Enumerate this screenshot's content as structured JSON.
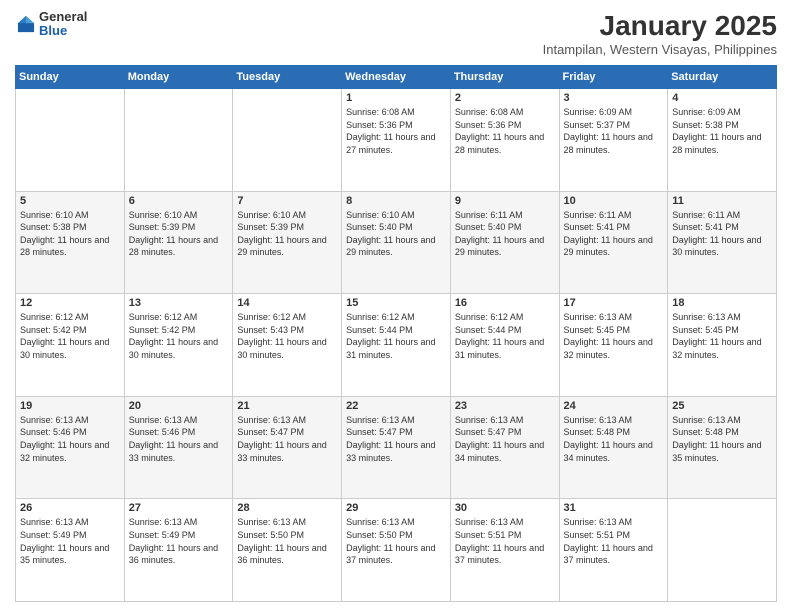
{
  "header": {
    "logo": {
      "general": "General",
      "blue": "Blue"
    },
    "title": "January 2025",
    "subtitle": "Intampilan, Western Visayas, Philippines"
  },
  "weekdays": [
    "Sunday",
    "Monday",
    "Tuesday",
    "Wednesday",
    "Thursday",
    "Friday",
    "Saturday"
  ],
  "weeks": [
    [
      {
        "day": "",
        "sunrise": "",
        "sunset": "",
        "daylight": ""
      },
      {
        "day": "",
        "sunrise": "",
        "sunset": "",
        "daylight": ""
      },
      {
        "day": "",
        "sunrise": "",
        "sunset": "",
        "daylight": ""
      },
      {
        "day": "1",
        "sunrise": "6:08 AM",
        "sunset": "5:36 PM",
        "daylight": "11 hours and 27 minutes."
      },
      {
        "day": "2",
        "sunrise": "6:08 AM",
        "sunset": "5:36 PM",
        "daylight": "11 hours and 28 minutes."
      },
      {
        "day": "3",
        "sunrise": "6:09 AM",
        "sunset": "5:37 PM",
        "daylight": "11 hours and 28 minutes."
      },
      {
        "day": "4",
        "sunrise": "6:09 AM",
        "sunset": "5:38 PM",
        "daylight": "11 hours and 28 minutes."
      }
    ],
    [
      {
        "day": "5",
        "sunrise": "6:10 AM",
        "sunset": "5:38 PM",
        "daylight": "11 hours and 28 minutes."
      },
      {
        "day": "6",
        "sunrise": "6:10 AM",
        "sunset": "5:39 PM",
        "daylight": "11 hours and 28 minutes."
      },
      {
        "day": "7",
        "sunrise": "6:10 AM",
        "sunset": "5:39 PM",
        "daylight": "11 hours and 29 minutes."
      },
      {
        "day": "8",
        "sunrise": "6:10 AM",
        "sunset": "5:40 PM",
        "daylight": "11 hours and 29 minutes."
      },
      {
        "day": "9",
        "sunrise": "6:11 AM",
        "sunset": "5:40 PM",
        "daylight": "11 hours and 29 minutes."
      },
      {
        "day": "10",
        "sunrise": "6:11 AM",
        "sunset": "5:41 PM",
        "daylight": "11 hours and 29 minutes."
      },
      {
        "day": "11",
        "sunrise": "6:11 AM",
        "sunset": "5:41 PM",
        "daylight": "11 hours and 30 minutes."
      }
    ],
    [
      {
        "day": "12",
        "sunrise": "6:12 AM",
        "sunset": "5:42 PM",
        "daylight": "11 hours and 30 minutes."
      },
      {
        "day": "13",
        "sunrise": "6:12 AM",
        "sunset": "5:42 PM",
        "daylight": "11 hours and 30 minutes."
      },
      {
        "day": "14",
        "sunrise": "6:12 AM",
        "sunset": "5:43 PM",
        "daylight": "11 hours and 30 minutes."
      },
      {
        "day": "15",
        "sunrise": "6:12 AM",
        "sunset": "5:44 PM",
        "daylight": "11 hours and 31 minutes."
      },
      {
        "day": "16",
        "sunrise": "6:12 AM",
        "sunset": "5:44 PM",
        "daylight": "11 hours and 31 minutes."
      },
      {
        "day": "17",
        "sunrise": "6:13 AM",
        "sunset": "5:45 PM",
        "daylight": "11 hours and 32 minutes."
      },
      {
        "day": "18",
        "sunrise": "6:13 AM",
        "sunset": "5:45 PM",
        "daylight": "11 hours and 32 minutes."
      }
    ],
    [
      {
        "day": "19",
        "sunrise": "6:13 AM",
        "sunset": "5:46 PM",
        "daylight": "11 hours and 32 minutes."
      },
      {
        "day": "20",
        "sunrise": "6:13 AM",
        "sunset": "5:46 PM",
        "daylight": "11 hours and 33 minutes."
      },
      {
        "day": "21",
        "sunrise": "6:13 AM",
        "sunset": "5:47 PM",
        "daylight": "11 hours and 33 minutes."
      },
      {
        "day": "22",
        "sunrise": "6:13 AM",
        "sunset": "5:47 PM",
        "daylight": "11 hours and 33 minutes."
      },
      {
        "day": "23",
        "sunrise": "6:13 AM",
        "sunset": "5:47 PM",
        "daylight": "11 hours and 34 minutes."
      },
      {
        "day": "24",
        "sunrise": "6:13 AM",
        "sunset": "5:48 PM",
        "daylight": "11 hours and 34 minutes."
      },
      {
        "day": "25",
        "sunrise": "6:13 AM",
        "sunset": "5:48 PM",
        "daylight": "11 hours and 35 minutes."
      }
    ],
    [
      {
        "day": "26",
        "sunrise": "6:13 AM",
        "sunset": "5:49 PM",
        "daylight": "11 hours and 35 minutes."
      },
      {
        "day": "27",
        "sunrise": "6:13 AM",
        "sunset": "5:49 PM",
        "daylight": "11 hours and 36 minutes."
      },
      {
        "day": "28",
        "sunrise": "6:13 AM",
        "sunset": "5:50 PM",
        "daylight": "11 hours and 36 minutes."
      },
      {
        "day": "29",
        "sunrise": "6:13 AM",
        "sunset": "5:50 PM",
        "daylight": "11 hours and 37 minutes."
      },
      {
        "day": "30",
        "sunrise": "6:13 AM",
        "sunset": "5:51 PM",
        "daylight": "11 hours and 37 minutes."
      },
      {
        "day": "31",
        "sunrise": "6:13 AM",
        "sunset": "5:51 PM",
        "daylight": "11 hours and 37 minutes."
      },
      {
        "day": "",
        "sunrise": "",
        "sunset": "",
        "daylight": ""
      }
    ]
  ],
  "labels": {
    "sunrise_prefix": "Sunrise: ",
    "sunset_prefix": "Sunset: ",
    "daylight_prefix": "Daylight: "
  }
}
